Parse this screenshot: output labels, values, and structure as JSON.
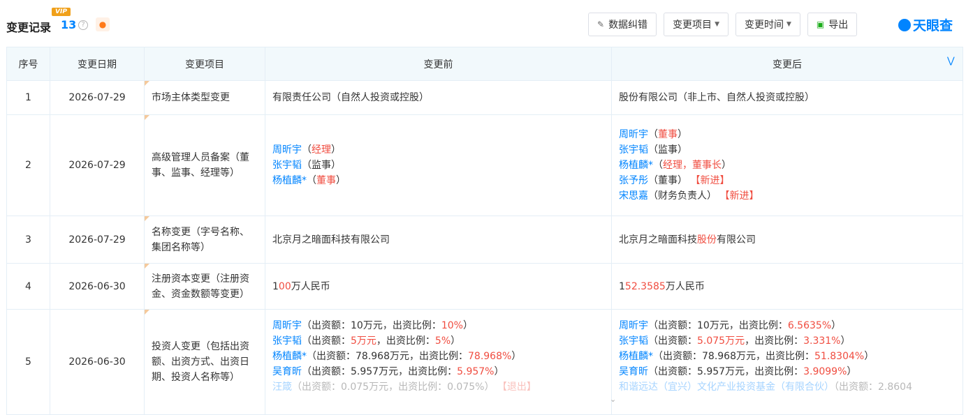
{
  "header": {
    "vip_badge": "VIP",
    "title": "变更记录",
    "count": "13",
    "help_icon": "question-icon",
    "bell_icon": "bell-icon",
    "buttons": {
      "report_error": "数据纠错",
      "change_item": "变更项目",
      "change_time": "变更时间",
      "export": "导出"
    },
    "brand": "天眼查"
  },
  "table": {
    "columns": [
      "序号",
      "变更日期",
      "变更项目",
      "变更前",
      "变更后"
    ],
    "rows": [
      {
        "no": "1",
        "date": "2026-07-29",
        "item": "市场主体类型变更",
        "before_highlight": "有限责任公司（自然人投资或控股）",
        "after_highlight": "股份有限公司（非上市、自然人投资或控股）"
      },
      {
        "no": "2",
        "date": "2026-07-29",
        "item": "高级管理人员备案（董事、监事、经理等）",
        "before": [
          {
            "name": "周昕宇",
            "open": "（",
            "role": "经理",
            "close": "）"
          },
          {
            "name": "张宇韬",
            "open": "（",
            "role": "监事",
            "close": "）"
          },
          {
            "name": "杨植麟*",
            "open": "（",
            "role": "董事",
            "close": "）"
          }
        ],
        "after": [
          {
            "name": "周昕宇",
            "open": "（",
            "role": "董事",
            "close": "）",
            "tag": ""
          },
          {
            "name": "张宇韬",
            "open": "（",
            "role": "监事",
            "close": "）",
            "tag": ""
          },
          {
            "name": "杨植麟*",
            "open": "（",
            "role": "经理，董事长",
            "close": "）",
            "tag": ""
          },
          {
            "name": "张予彤",
            "open": "（",
            "role": "董事",
            "close": "）",
            "tag": "【新进】"
          },
          {
            "name": "宋思嘉",
            "open": "（",
            "role": "财务负责人",
            "close": "）",
            "tag": "【新进】"
          }
        ]
      },
      {
        "no": "3",
        "date": "2026-07-29",
        "item": "名称变更（字号名称、集团名称等）",
        "before": "北京月之暗面科技有限公司",
        "after_prefix": "北京月之暗面科技",
        "after_highlight": "股份",
        "after_suffix": "有限公司"
      },
      {
        "no": "4",
        "date": "2026-06-30",
        "item": "注册资本变更（注册资金、资金数额等变更）",
        "before_prefix": "1",
        "before_highlight": "00",
        "before_suffix": "万人民币",
        "after_prefix": "1",
        "after_highlight": "52.3585",
        "after_suffix": "万人民币"
      },
      {
        "no": "5",
        "date": "2026-06-30",
        "item": "投资人变更（包括出资额、出资方式、出资日期、投资人名称等）",
        "before": [
          {
            "name": "周昕宇",
            "p1": "（出资额：10万元，出资比例：",
            "amount_hl": "",
            "ratio_hl": "10%",
            "p2": "）",
            "tag": ""
          },
          {
            "name": "张宇韬",
            "p1": "（出资额：",
            "amount_hl": "5万元",
            "p1b": "，出资比例：",
            "ratio_hl": "5%",
            "p2": "）",
            "tag": ""
          },
          {
            "name": "杨植麟*",
            "p1": "（出资额：78.968万元，出资比例：",
            "amount_hl": "",
            "ratio_hl": "78.968%",
            "p2": "）",
            "tag": ""
          },
          {
            "name": "吴育昕",
            "p1": "（出资额：5.957万元，出资比例：",
            "amount_hl": "",
            "ratio_hl": "5.957%",
            "p2": "）",
            "tag": ""
          },
          {
            "name": "汪箴",
            "p1": "（出资额：0.075万元，出资比例：0.075%）",
            "amount_hl": "",
            "ratio_hl": "",
            "p2": "",
            "tag": "【退出】"
          }
        ],
        "after": [
          {
            "name": "周昕宇",
            "p1": "（出资额：10万元，出资比例：",
            "ratio_hl": "6.5635%",
            "p2": "）"
          },
          {
            "name": "张宇韬",
            "p1": "（出资额：",
            "amount_hl": "5.075万元",
            "p1b": "，出资比例：",
            "ratio_hl": "3.331%",
            "p2": "）"
          },
          {
            "name": "杨植麟*",
            "p1": "（出资额：78.968万元，出资比例：",
            "ratio_hl": "51.8304%",
            "p2": "）"
          },
          {
            "name": "吴育昕",
            "p1": "（出资额：5.957万元，出资比例：",
            "ratio_hl": "3.9099%",
            "p2": "）"
          },
          {
            "name": "和谐远达（宜兴）文化产业投资基金（有限合伙）",
            "p1": "（出资额：2.8604"
          }
        ]
      }
    ]
  },
  "icons": {
    "collapse": "double-chevron-down-icon",
    "more": "chevron-down-icon"
  },
  "colors": {
    "accent": "#0084ff",
    "highlight": "#f04d40",
    "header_bg": "#f2f9fc"
  }
}
